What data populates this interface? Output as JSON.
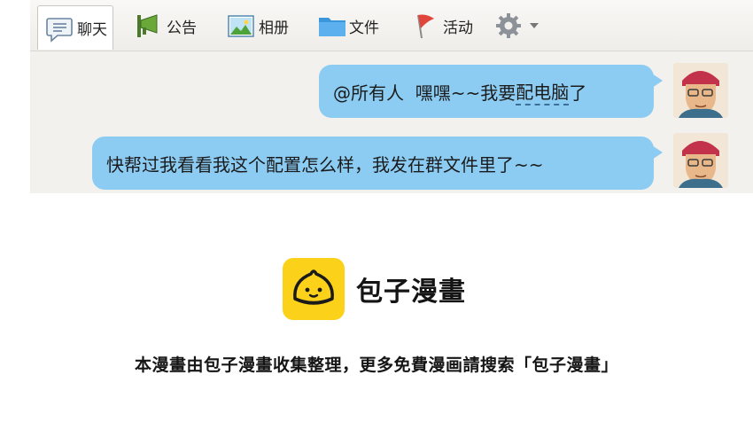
{
  "toolbar": {
    "tabs": [
      {
        "label": "聊天",
        "icon": "chat-icon"
      },
      {
        "label": "公告",
        "icon": "megaphone-icon"
      },
      {
        "label": "相册",
        "icon": "photo-album-icon"
      },
      {
        "label": "文件",
        "icon": "folder-icon"
      },
      {
        "label": "活动",
        "icon": "flag-icon"
      }
    ],
    "settings_icon": "gear-icon",
    "dropdown_icon": "caret-down-icon"
  },
  "messages": [
    {
      "text_prefix": "@所有人  嘿嘿~~我要",
      "text_highlight": "配电脑",
      "text_suffix": "了"
    },
    {
      "text": "快帮过我看看我这个配置怎么样，我发在群文件里了~~"
    }
  ],
  "brand": {
    "name": "包子漫畫",
    "footer": "本漫畫由包子漫畫收集整理，更多免費漫画請搜索「包子漫畫」"
  },
  "colors": {
    "bubble": "#8cccf3",
    "logo": "#fbd11a",
    "chat_background": "#f3f1ee"
  }
}
